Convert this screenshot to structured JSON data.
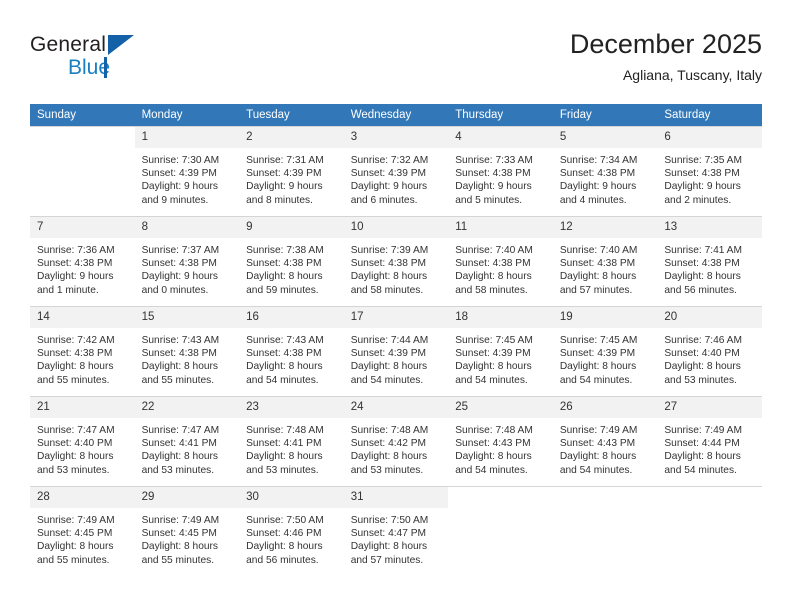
{
  "brand": {
    "line1": "General",
    "line2": "Blue",
    "triangle_color": "#1461a8",
    "text_color": "#231f20",
    "accent_color": "#1a7fc1"
  },
  "header": {
    "month_title": "December 2025",
    "location": "Agliana, Tuscany, Italy"
  },
  "theme": {
    "header_row_bg": "#3277b8",
    "header_row_text": "#ffffff",
    "daynum_bg": "#f2f2f2",
    "cell_border": "#d5d5d5",
    "body_text": "#333333"
  },
  "weekdays": [
    "Sunday",
    "Monday",
    "Tuesday",
    "Wednesday",
    "Thursday",
    "Friday",
    "Saturday"
  ],
  "weeks": [
    [
      {
        "day": "",
        "lines": []
      },
      {
        "day": "1",
        "lines": [
          "Sunrise: 7:30 AM",
          "Sunset: 4:39 PM",
          "Daylight: 9 hours",
          "and 9 minutes."
        ]
      },
      {
        "day": "2",
        "lines": [
          "Sunrise: 7:31 AM",
          "Sunset: 4:39 PM",
          "Daylight: 9 hours",
          "and 8 minutes."
        ]
      },
      {
        "day": "3",
        "lines": [
          "Sunrise: 7:32 AM",
          "Sunset: 4:39 PM",
          "Daylight: 9 hours",
          "and 6 minutes."
        ]
      },
      {
        "day": "4",
        "lines": [
          "Sunrise: 7:33 AM",
          "Sunset: 4:38 PM",
          "Daylight: 9 hours",
          "and 5 minutes."
        ]
      },
      {
        "day": "5",
        "lines": [
          "Sunrise: 7:34 AM",
          "Sunset: 4:38 PM",
          "Daylight: 9 hours",
          "and 4 minutes."
        ]
      },
      {
        "day": "6",
        "lines": [
          "Sunrise: 7:35 AM",
          "Sunset: 4:38 PM",
          "Daylight: 9 hours",
          "and 2 minutes."
        ]
      }
    ],
    [
      {
        "day": "7",
        "lines": [
          "Sunrise: 7:36 AM",
          "Sunset: 4:38 PM",
          "Daylight: 9 hours",
          "and 1 minute."
        ]
      },
      {
        "day": "8",
        "lines": [
          "Sunrise: 7:37 AM",
          "Sunset: 4:38 PM",
          "Daylight: 9 hours",
          "and 0 minutes."
        ]
      },
      {
        "day": "9",
        "lines": [
          "Sunrise: 7:38 AM",
          "Sunset: 4:38 PM",
          "Daylight: 8 hours",
          "and 59 minutes."
        ]
      },
      {
        "day": "10",
        "lines": [
          "Sunrise: 7:39 AM",
          "Sunset: 4:38 PM",
          "Daylight: 8 hours",
          "and 58 minutes."
        ]
      },
      {
        "day": "11",
        "lines": [
          "Sunrise: 7:40 AM",
          "Sunset: 4:38 PM",
          "Daylight: 8 hours",
          "and 58 minutes."
        ]
      },
      {
        "day": "12",
        "lines": [
          "Sunrise: 7:40 AM",
          "Sunset: 4:38 PM",
          "Daylight: 8 hours",
          "and 57 minutes."
        ]
      },
      {
        "day": "13",
        "lines": [
          "Sunrise: 7:41 AM",
          "Sunset: 4:38 PM",
          "Daylight: 8 hours",
          "and 56 minutes."
        ]
      }
    ],
    [
      {
        "day": "14",
        "lines": [
          "Sunrise: 7:42 AM",
          "Sunset: 4:38 PM",
          "Daylight: 8 hours",
          "and 55 minutes."
        ]
      },
      {
        "day": "15",
        "lines": [
          "Sunrise: 7:43 AM",
          "Sunset: 4:38 PM",
          "Daylight: 8 hours",
          "and 55 minutes."
        ]
      },
      {
        "day": "16",
        "lines": [
          "Sunrise: 7:43 AM",
          "Sunset: 4:38 PM",
          "Daylight: 8 hours",
          "and 54 minutes."
        ]
      },
      {
        "day": "17",
        "lines": [
          "Sunrise: 7:44 AM",
          "Sunset: 4:39 PM",
          "Daylight: 8 hours",
          "and 54 minutes."
        ]
      },
      {
        "day": "18",
        "lines": [
          "Sunrise: 7:45 AM",
          "Sunset: 4:39 PM",
          "Daylight: 8 hours",
          "and 54 minutes."
        ]
      },
      {
        "day": "19",
        "lines": [
          "Sunrise: 7:45 AM",
          "Sunset: 4:39 PM",
          "Daylight: 8 hours",
          "and 54 minutes."
        ]
      },
      {
        "day": "20",
        "lines": [
          "Sunrise: 7:46 AM",
          "Sunset: 4:40 PM",
          "Daylight: 8 hours",
          "and 53 minutes."
        ]
      }
    ],
    [
      {
        "day": "21",
        "lines": [
          "Sunrise: 7:47 AM",
          "Sunset: 4:40 PM",
          "Daylight: 8 hours",
          "and 53 minutes."
        ]
      },
      {
        "day": "22",
        "lines": [
          "Sunrise: 7:47 AM",
          "Sunset: 4:41 PM",
          "Daylight: 8 hours",
          "and 53 minutes."
        ]
      },
      {
        "day": "23",
        "lines": [
          "Sunrise: 7:48 AM",
          "Sunset: 4:41 PM",
          "Daylight: 8 hours",
          "and 53 minutes."
        ]
      },
      {
        "day": "24",
        "lines": [
          "Sunrise: 7:48 AM",
          "Sunset: 4:42 PM",
          "Daylight: 8 hours",
          "and 53 minutes."
        ]
      },
      {
        "day": "25",
        "lines": [
          "Sunrise: 7:48 AM",
          "Sunset: 4:43 PM",
          "Daylight: 8 hours",
          "and 54 minutes."
        ]
      },
      {
        "day": "26",
        "lines": [
          "Sunrise: 7:49 AM",
          "Sunset: 4:43 PM",
          "Daylight: 8 hours",
          "and 54 minutes."
        ]
      },
      {
        "day": "27",
        "lines": [
          "Sunrise: 7:49 AM",
          "Sunset: 4:44 PM",
          "Daylight: 8 hours",
          "and 54 minutes."
        ]
      }
    ],
    [
      {
        "day": "28",
        "lines": [
          "Sunrise: 7:49 AM",
          "Sunset: 4:45 PM",
          "Daylight: 8 hours",
          "and 55 minutes."
        ]
      },
      {
        "day": "29",
        "lines": [
          "Sunrise: 7:49 AM",
          "Sunset: 4:45 PM",
          "Daylight: 8 hours",
          "and 55 minutes."
        ]
      },
      {
        "day": "30",
        "lines": [
          "Sunrise: 7:50 AM",
          "Sunset: 4:46 PM",
          "Daylight: 8 hours",
          "and 56 minutes."
        ]
      },
      {
        "day": "31",
        "lines": [
          "Sunrise: 7:50 AM",
          "Sunset: 4:47 PM",
          "Daylight: 8 hours",
          "and 57 minutes."
        ]
      },
      {
        "day": "",
        "lines": []
      },
      {
        "day": "",
        "lines": []
      },
      {
        "day": "",
        "lines": []
      }
    ]
  ]
}
